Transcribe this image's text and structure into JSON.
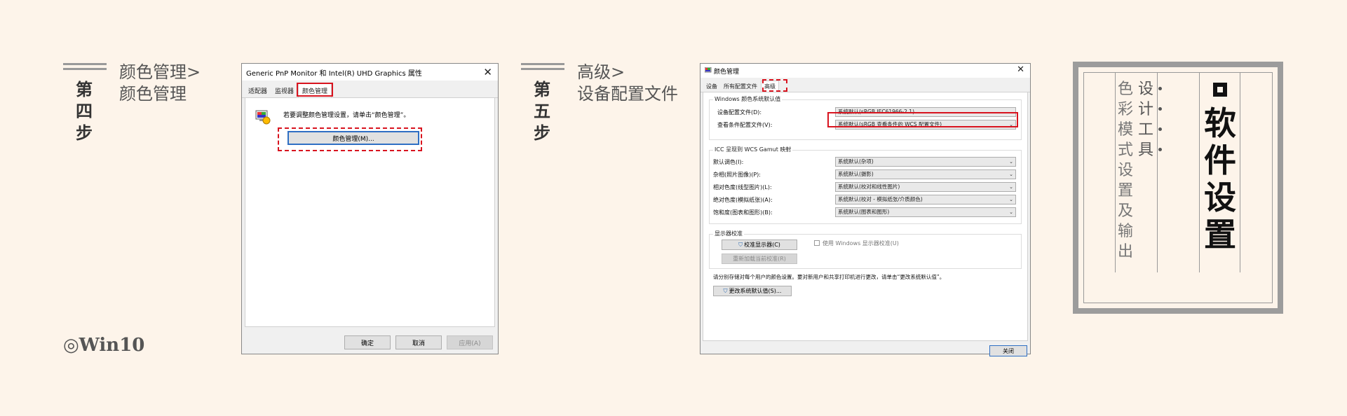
{
  "step4": {
    "label_chars": [
      "第",
      "四",
      "步"
    ],
    "path_line1": "颜色管理>",
    "path_line2": "颜色管理"
  },
  "step5": {
    "label_chars": [
      "第",
      "五",
      "步"
    ],
    "path_line1": "高级>",
    "path_line2": "设备配置文件"
  },
  "footer_note": "◎Win10",
  "dialog1": {
    "title": "Generic PnP Monitor 和 Intel(R) UHD Graphics 属性",
    "tabs": [
      "适配器",
      "监视器",
      "颜色管理"
    ],
    "active_tab": "颜色管理",
    "instruction": "若要调整颜色管理设置，请单击“颜色管理”。",
    "color_mgmt_button": "颜色管理(M)...",
    "ok_button": "确定",
    "cancel_button": "取消",
    "apply_button": "应用(A)"
  },
  "dialog2": {
    "title": "颜色管理",
    "tabs": [
      "设备",
      "所有配置文件",
      "高级"
    ],
    "active_tab": "高级",
    "group1_title": "Windows 颜色系统默认值",
    "device_profile_label": "设备配置文件(D):",
    "device_profile_value": "系统默认(sRGB IEC61966-2.1)",
    "viewing_cond_label": "查看条件配置文件(V):",
    "viewing_cond_value": "系统默认(sRGB 查看条件的 WCS 配置文件)",
    "group2_title": "ICC 呈现到 WCS Gamut 映射",
    "intents": [
      {
        "label": "默认调色(I):",
        "value": "系统默认(杂项)"
      },
      {
        "label": "杂相(照片图像)(P):",
        "value": "系统默认(摄影)"
      },
      {
        "label": "相对色度(线型图片)(L):",
        "value": "系统默认(校对和线性图片)"
      },
      {
        "label": "绝对色度(模拟纸张)(A):",
        "value": "系统默认(校对 - 模拟纸张/介质颜色)"
      },
      {
        "label": "饱和度(图表和图形)(B):",
        "value": "系统默认(图表和图形)"
      }
    ],
    "group3_title": "显示器校准",
    "calibrate_button": "校准显示器(C)",
    "reload_button": "重新加载当前校准(R)",
    "use_windows_cal": "使用 Windows 显示器校准(U)",
    "info_text": "请分别存储对每个用户的颜色设置。要对新用户和共享打印机进行更改，请单击“更改系统默认值”。",
    "change_defaults_button": "更改系统默认值(S)...",
    "close_button": "关闭"
  },
  "card": {
    "main_title_chars": [
      "软",
      "件",
      "设",
      "置"
    ],
    "tool_chars": [
      "设",
      "计",
      "工",
      "具"
    ],
    "desc_chars": [
      "色",
      "彩",
      "模",
      "式",
      "设",
      "置",
      "及",
      "输",
      "出"
    ]
  },
  "colors": {
    "background": "#fdf4ea",
    "highlight_red": "#d8141f",
    "frame_gray": "#9c9c9c"
  }
}
